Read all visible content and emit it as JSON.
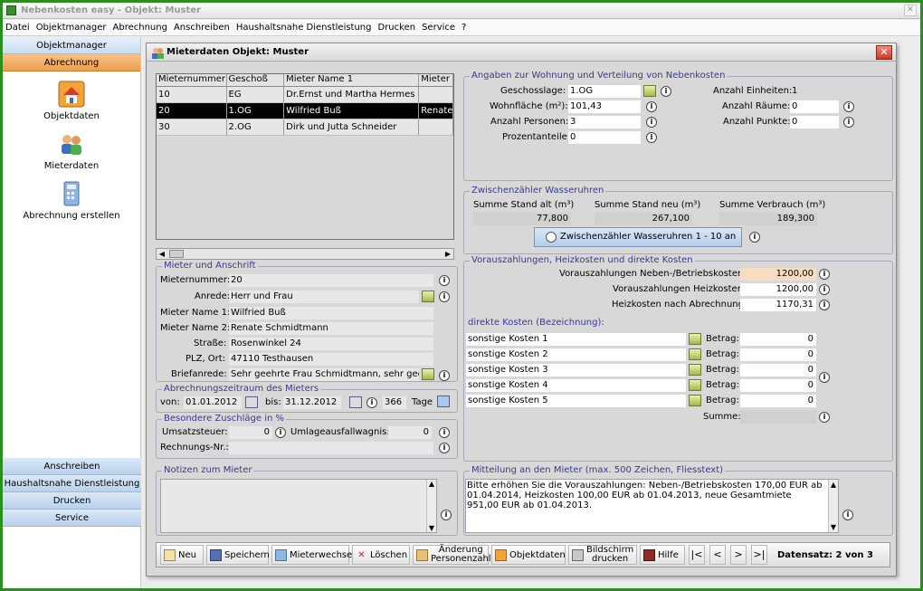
{
  "app": {
    "title": "Nebenkosten easy - Objekt: Muster"
  },
  "menu": [
    "Datei",
    "Objektmanager",
    "Abrechnung",
    "Anschreiben",
    "Haushaltsnahe Dienstleistung",
    "Drucken",
    "Service",
    "?"
  ],
  "sidebar": {
    "top_buttons": [
      "Objektmanager",
      "Abrechnung"
    ],
    "items": [
      {
        "label": "Objektdaten",
        "icon": "house-icon"
      },
      {
        "label": "Mieterdaten",
        "icon": "tenants-icon"
      },
      {
        "label": "Abrechnung erstellen",
        "icon": "calculator-icon"
      }
    ],
    "bottom_buttons": [
      "Anschreiben",
      "Haushaltsnahe Dienstleistung",
      "Drucken",
      "Service"
    ]
  },
  "window": {
    "title": "Mieterdaten  Objekt: Muster",
    "table": {
      "columns": [
        "Mieternummer",
        "Geschoß",
        "Mieter Name 1",
        "Mieter N"
      ],
      "rows": [
        [
          "10",
          "EG",
          "Dr.Ernst und Martha Hermes",
          ""
        ],
        [
          "20",
          "1.OG",
          "Wilfried Buß",
          "Renate"
        ],
        [
          "30",
          "2.OG",
          "Dirk und Jutta Schneider",
          ""
        ]
      ]
    },
    "mieter": {
      "legend": "Mieter und Anschrift",
      "l_nr": "Mieternummer:",
      "nr": "20",
      "l_anrede": "Anrede:",
      "anrede": "Herr und Frau",
      "l_name1": "Mieter Name 1:",
      "name1": "Wilfried Buß",
      "l_name2": "Mieter Name 2:",
      "name2": "Renate Schmidtmann",
      "l_strasse": "Straße:",
      "strasse": "Rosenwinkel 24",
      "l_plz": "PLZ, Ort:",
      "plz": "47110 Testhausen",
      "l_brief": "Briefanrede:",
      "brief": "Sehr geehrte Frau Schmidtmann, sehr geeh"
    },
    "zeitraum": {
      "legend": "Abrechnungszeitraum des Mieters",
      "l_von": "von:",
      "von": "01.01.2012",
      "l_bis": "bis:",
      "bis": "31.12.2012",
      "tage": "366",
      "l_tage": "Tage"
    },
    "zuschlaege": {
      "legend": "Besondere Zuschläge in %",
      "l_ust": "Umsatzsteuer:",
      "ust": "0",
      "l_umlage": "Umlageausfallwagnis:",
      "umlage": "0",
      "l_rnr": "Rechnungs-Nr.:",
      "rnr": ""
    },
    "notizen": {
      "legend": "Notizen zum Mieter",
      "text": ""
    },
    "wohnung": {
      "legend": "Angaben zur Wohnung und Verteilung von Nebenkosten",
      "l_geschoss": "Geschosslage:",
      "geschoss": "1.OG",
      "l_flaeche": "Wohnfläche (m²):",
      "flaeche": "101,43",
      "l_personen": "Anzahl Personen:",
      "personen": "3",
      "l_prozent": "Prozentanteile:",
      "prozent": "0",
      "l_einheiten": "Anzahl Einheiten:",
      "einheiten": "1",
      "l_raeume": "Anzahl Räume:",
      "raeume": "0",
      "l_punkte": "Anzahl Punkte:",
      "punkte": "0"
    },
    "wasser": {
      "legend": "Zwischenzähler Wasseruhren",
      "l_alt": "Summe Stand alt (m³)",
      "alt": "77,800",
      "l_neu": "Summe Stand neu (m³)",
      "neu": "267,100",
      "l_verb": "Summe Verbrauch (m³)",
      "verb": "189,300",
      "button": "Zwischenzähler Wasseruhren 1 - 10 an"
    },
    "vz": {
      "legend": "Vorauszahlungen, Heizkosten und direkte Kosten",
      "l_vz_neben": "Vorauszahlungen Neben-/Betriebskosten:",
      "vz_neben": "1200,00",
      "l_vz_heiz": "Vorauszahlungen Heizkosten:",
      "vz_heiz": "1200,00",
      "l_heiz": "Heizkosten nach Abrechnung:",
      "heiz": "1170,31",
      "l_direkt": "direkte Kosten (Bezeichnung):",
      "kosten": [
        {
          "name": "sonstige Kosten 1",
          "l_betrag": "Betrag:",
          "betrag": "0"
        },
        {
          "name": "sonstige Kosten 2",
          "l_betrag": "Betrag:",
          "betrag": "0"
        },
        {
          "name": "sonstige Kosten 3",
          "l_betrag": "Betrag:",
          "betrag": "0"
        },
        {
          "name": "sonstige Kosten 4",
          "l_betrag": "Betrag:",
          "betrag": "0"
        },
        {
          "name": "sonstige Kosten 5",
          "l_betrag": "Betrag:",
          "betrag": "0"
        }
      ],
      "l_summe": "Summe:",
      "summe": ""
    },
    "mitteilung": {
      "legend": "Mitteilung an den Mieter (max. 500 Zeichen, Fliesstext)",
      "text": "Bitte erhöhen Sie die Vorauszahlungen: Neben-/Betriebskosten 170,00 EUR ab 01.04.2014, Heizkosten 100,00 EUR ab 01.04.2013, neue Gesamtmiete 951,00 EUR ab 01.04.2013."
    },
    "toolbar": {
      "neu": "Neu",
      "speichern": "Speichern",
      "wechsel": "Mieterwechsel",
      "loeschen": "Löschen",
      "aend1": "Änderung",
      "aend2": "Personenzahl",
      "objekt": "Objektdaten",
      "bild1": "Bildschirm",
      "bild2": "drucken",
      "hilfe": "Hilfe",
      "nav": [
        "|<",
        "<",
        ">",
        ">|"
      ],
      "datensatz": "Datensatz: 2 von 3"
    }
  }
}
